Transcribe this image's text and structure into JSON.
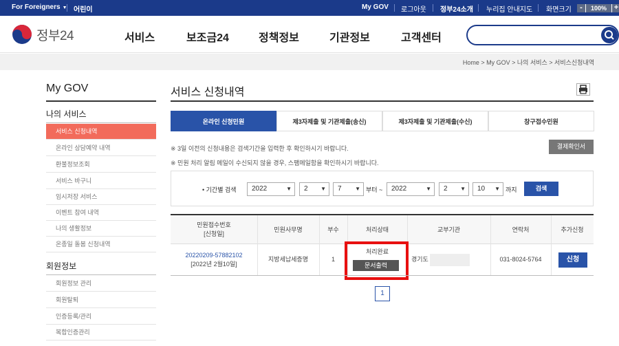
{
  "topbar": {
    "for_foreigners": "For Foreigners",
    "kids": "어린이",
    "my_gov": "My GOV",
    "logout": "로그아웃",
    "about": "정부24소개",
    "sitemap": "누리집 안내지도",
    "screen_size": "화면크기",
    "zoom_minus": "-",
    "zoom_value": "100%",
    "zoom_plus": "+"
  },
  "header": {
    "logo_text": "정부24",
    "nav": [
      "서비스",
      "보조금24",
      "정책정보",
      "기관정보",
      "고객센터"
    ]
  },
  "breadcrumb": "Home  >  My GOV  >  나의 서비스  >  서비스신청내역",
  "lnb": {
    "title": "My GOV",
    "section1": "나의 서비스",
    "items1": [
      "서비스 신청내역",
      "온라인 상담예약 내역",
      "환불정보조회",
      "서비스 바구니",
      "임시저장 서비스",
      "이벤트 참여 내역",
      "나의 생활정보",
      "온종일 돌봄 신청내역"
    ],
    "section2": "회원정보",
    "items2": [
      "회원정보 관리",
      "회원탈퇴",
      "인증등록/관리",
      "복합인증관리"
    ]
  },
  "main": {
    "title": "서비스 신청내역",
    "tabs": [
      "온라인 신청민원",
      "제3자제출 및 기관제출(송신)",
      "제3자제출 및 기관제출(수신)",
      "창구접수민원"
    ],
    "notice1": "※ 3일 이전의 신청내용은 검색기간을 입력한 후 확인하시기 바랍니다.",
    "notice2": "※ 민원 처리 알림 메일이 수신되지 않을 경우, 스팸메일함을 확인하시기 바랍니다.",
    "confirm_btn": "결제확인서",
    "period_label": "• 기간별 검색",
    "from_year": "2022",
    "from_month": "2",
    "from_day": "7",
    "from_suffix": "부터 ~",
    "to_year": "2022",
    "to_month": "2",
    "to_day": "10",
    "to_suffix": "까지",
    "search_btn": "검색"
  },
  "table": {
    "headers": [
      "민원접수번호\n[신청일]",
      "민원사무명",
      "부수",
      "처리상태",
      "교부기관",
      "연락처",
      "추가신청"
    ],
    "row": {
      "id": "20220209-57882102",
      "date": "[2022년 2월10일]",
      "name": "지방세납세증명",
      "copies": "1",
      "status": "처리완료",
      "print_btn": "문서출력",
      "agency": "경기도",
      "phone": "031-8024-5764",
      "apply_btn": "신청"
    }
  },
  "pagination": {
    "current": "1"
  }
}
